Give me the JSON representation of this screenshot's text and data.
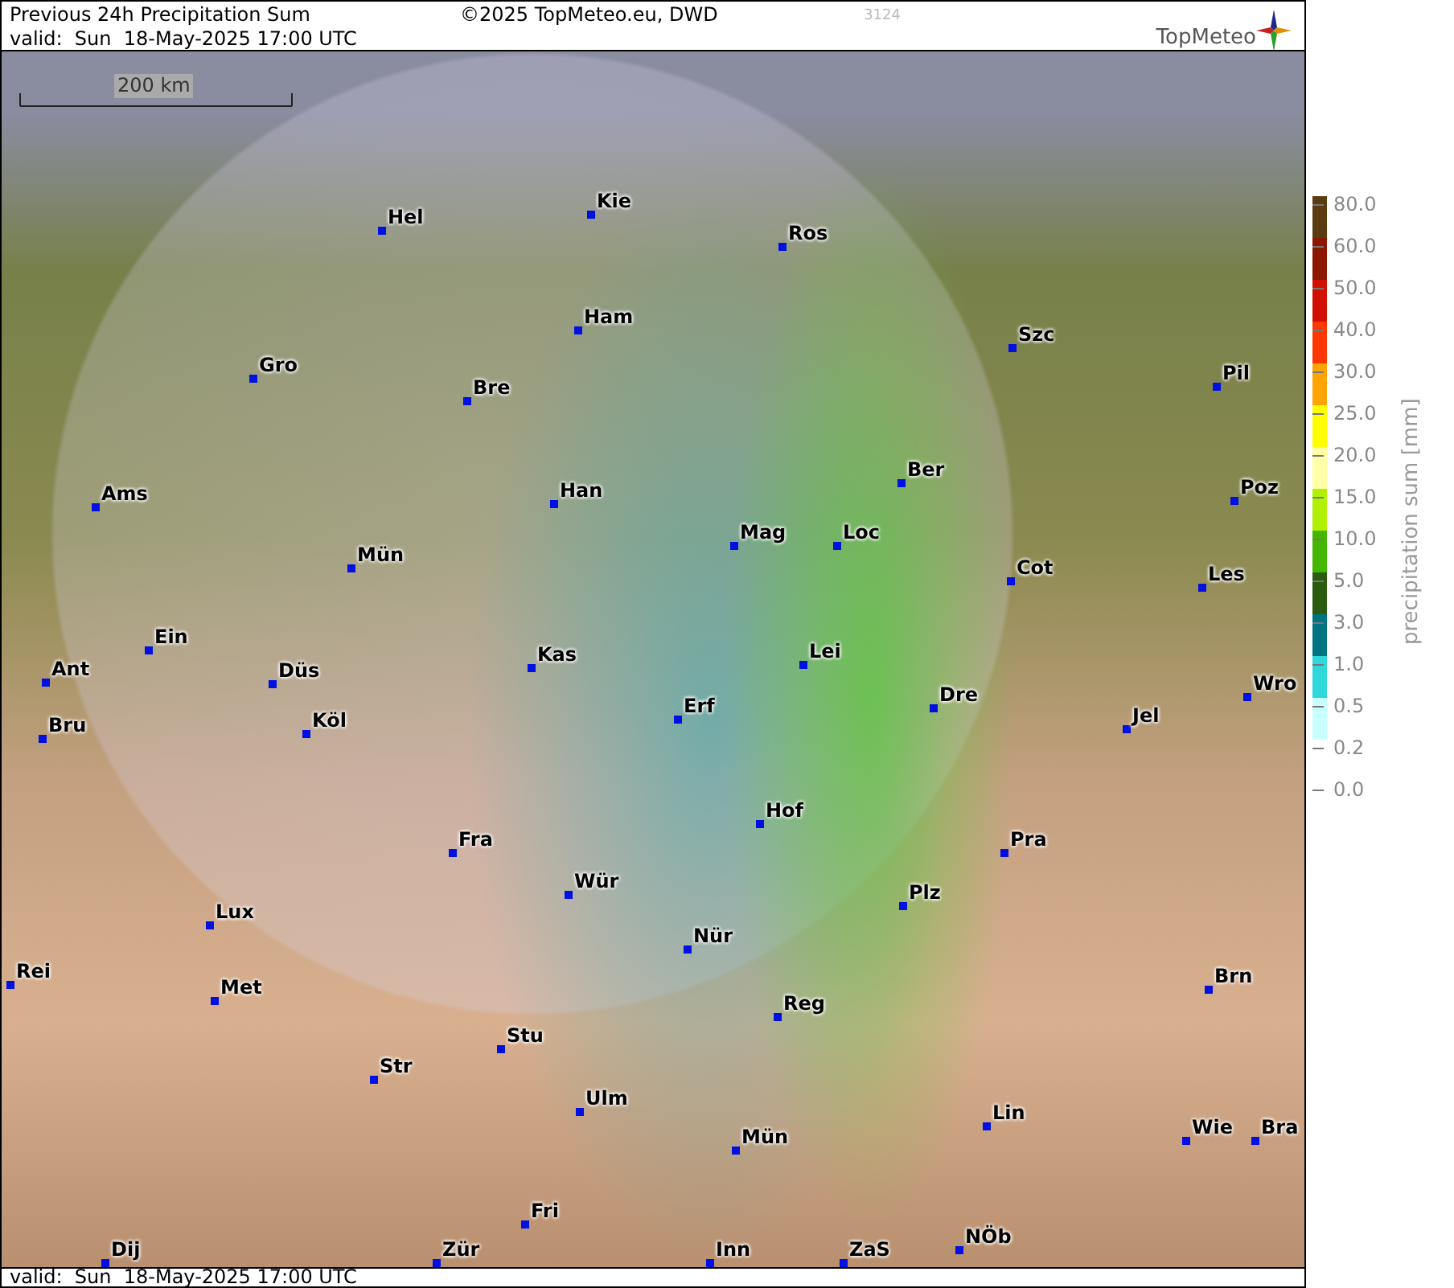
{
  "header": {
    "title": "Previous 24h Precipitation Sum",
    "valid": "valid:  Sun  18-May-2025 17:00 UTC",
    "copyright": "©2025 TopMeteo.eu, DWD",
    "counter": "3124",
    "logo": "TopMeteo"
  },
  "map": {
    "scale": "200 km",
    "cities": [
      {
        "name": "Hel"
      },
      {
        "name": "Kie"
      },
      {
        "name": "Ros"
      },
      {
        "name": "Ham"
      },
      {
        "name": "Szc"
      },
      {
        "name": "Gro"
      },
      {
        "name": "Bre"
      },
      {
        "name": "Pil"
      },
      {
        "name": "Ber"
      },
      {
        "name": "Ams"
      },
      {
        "name": "Han"
      },
      {
        "name": "Mag"
      },
      {
        "name": "Loc"
      },
      {
        "name": "Poz"
      },
      {
        "name": "Mün"
      },
      {
        "name": "Cot"
      },
      {
        "name": "Les"
      },
      {
        "name": "Ein"
      },
      {
        "name": "Kas"
      },
      {
        "name": "Lei"
      },
      {
        "name": "Ant"
      },
      {
        "name": "Düs"
      },
      {
        "name": "Wro"
      },
      {
        "name": "Bru"
      },
      {
        "name": "Köl"
      },
      {
        "name": "Erf"
      },
      {
        "name": "Dre"
      },
      {
        "name": "Jel"
      },
      {
        "name": "Hof"
      },
      {
        "name": "Fra"
      },
      {
        "name": "Pra"
      },
      {
        "name": "Wür"
      },
      {
        "name": "Plz"
      },
      {
        "name": "Lux"
      },
      {
        "name": "Nür"
      },
      {
        "name": "Rei"
      },
      {
        "name": "Met"
      },
      {
        "name": "Brn"
      },
      {
        "name": "Reg"
      },
      {
        "name": "Stu"
      },
      {
        "name": "Str"
      },
      {
        "name": "Ulm"
      },
      {
        "name": "Lin"
      },
      {
        "name": "Mün"
      },
      {
        "name": "Wie"
      },
      {
        "name": "Bra"
      },
      {
        "name": "Fri"
      },
      {
        "name": "NÖb"
      },
      {
        "name": "Dij"
      },
      {
        "name": "Zür"
      },
      {
        "name": "Inn"
      },
      {
        "name": "ZaS"
      }
    ]
  },
  "legend": {
    "title": "precipitation sum [mm]",
    "bands": [
      {
        "color": "#5a3c10"
      },
      {
        "color": "#8c1800"
      },
      {
        "color": "#d21000"
      },
      {
        "color": "#ff3800"
      },
      {
        "color": "#ffa400"
      },
      {
        "color": "#ffff00"
      },
      {
        "color": "#ffffa8"
      },
      {
        "color": "#b0f000"
      },
      {
        "color": "#44b800"
      },
      {
        "color": "#2c5c10"
      },
      {
        "color": "#007484"
      },
      {
        "color": "#30d8dc"
      },
      {
        "color": "#c8ffff"
      }
    ],
    "ticks": [
      "80.0",
      "60.0",
      "50.0",
      "40.0",
      "30.0",
      "25.0",
      "20.0",
      "15.0",
      "10.0",
      "5.0",
      "3.0",
      "1.0",
      "0.5",
      "0.2",
      "0.0"
    ]
  },
  "footer": {
    "valid": "valid:  Sun  18-May-2025 17:00 UTC"
  }
}
